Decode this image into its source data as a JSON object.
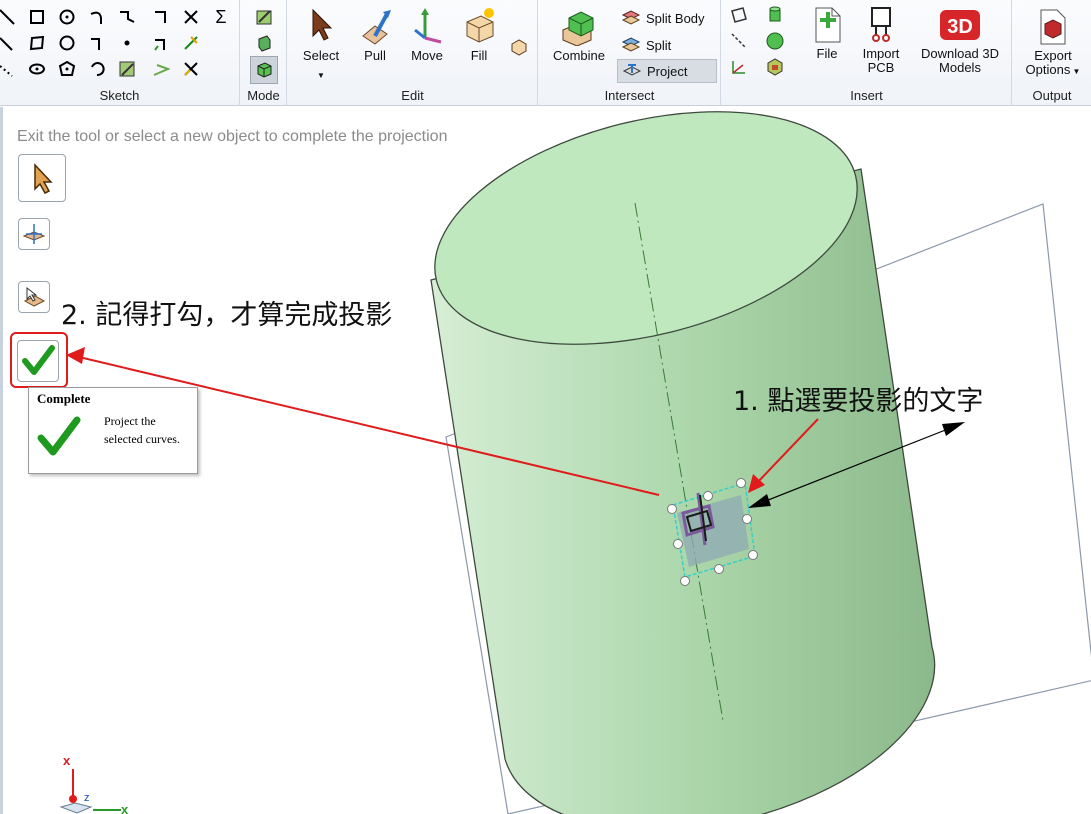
{
  "ribbon": {
    "groups": {
      "sketch": "Sketch",
      "mode": "Mode",
      "edit": "Edit",
      "intersect": "Intersect",
      "insert": "Insert",
      "output": "Output"
    },
    "edit": {
      "select": "Select",
      "pull": "Pull",
      "move": "Move",
      "fill": "Fill"
    },
    "intersect": {
      "combine": "Combine",
      "split_body": "Split Body",
      "split": "Split",
      "project": "Project"
    },
    "insert": {
      "file": "File",
      "import_pcb": "Import PCB",
      "download_3d": "Download 3D Models"
    },
    "output": {
      "export_options": "Export Options"
    }
  },
  "viewport": {
    "status_text": "Exit the tool or select a new object to complete the projection"
  },
  "tooltip": {
    "title": "Complete",
    "description": "Project the selected curves."
  },
  "annotations": {
    "step2": "2. 記得打勾，才算完成投影",
    "step1": "1. 點選要投影的文字"
  },
  "axis": {
    "x": "x",
    "z": "z"
  },
  "colors": {
    "cylinder": "#bfe6c0",
    "annotation_red": "#e01b1b",
    "check_green": "#1e9a1e",
    "projection_cyan": "#35d0c8"
  }
}
